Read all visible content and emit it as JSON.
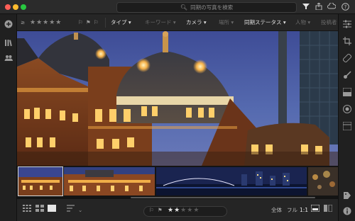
{
  "titlebar": {
    "search_placeholder": "同期の写真を検索"
  },
  "filterbar": {
    "stars": "★★★★★",
    "type_label": "タイプ",
    "keyword_label": "キーワード",
    "camera_label": "カメラ",
    "location_label": "場所",
    "sync_status_label": "同期ステータス",
    "people_label": "人物",
    "contributor_label": "投稿者"
  },
  "bottombar": {
    "rating": "★★★★★",
    "rating_filled": 2,
    "view_all": "全体",
    "view_fill": "フル",
    "view_one_to_one": "1:1"
  },
  "colors": {
    "accent_selected": "#d8d8d8",
    "panel_bg": "#262626"
  }
}
